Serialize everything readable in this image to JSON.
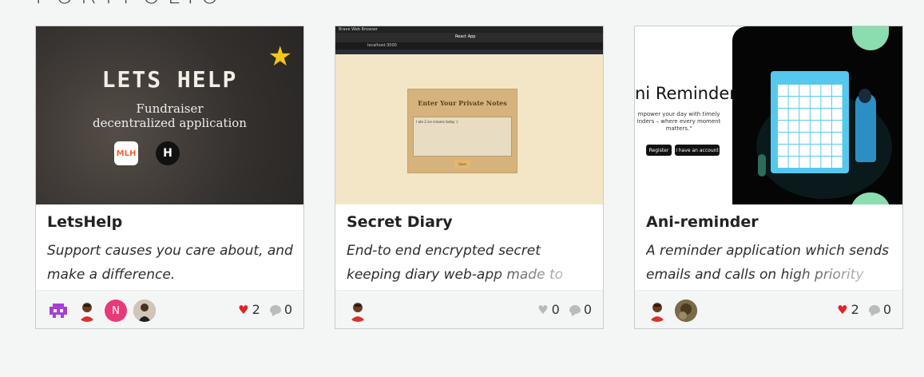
{
  "section": {
    "title": "PORTFOLIO"
  },
  "cards": [
    {
      "title": "LetsHelp",
      "description": "Support causes you care about, and make a difference.",
      "likes": "2",
      "comments": "0",
      "liked": true,
      "featured": true,
      "thumbnail": {
        "headline": "LETS HELP",
        "line1": "Fundraiser",
        "line2": "decentralized application",
        "badge1": "MLH",
        "badge2": "H"
      }
    },
    {
      "title": "Secret Diary",
      "description": "End-to end encrypted secret keeping diary web-app made to store and",
      "likes": "0",
      "comments": "0",
      "liked": false,
      "thumbnail": {
        "panel_title": "Enter Your Private Notes",
        "note_text": "I ate 2 ice creams today :)",
        "save_label": "Save",
        "browser_title": "Brave Web Browser",
        "tab_label": "React App",
        "url": "localhost:3000"
      }
    },
    {
      "title": "Ani-reminder",
      "description": "A reminder application which sends emails and calls on high priority",
      "likes": "2",
      "comments": "0",
      "liked": true,
      "thumbnail": {
        "heading": "ni Reminder",
        "tagline": "mpower your day with timely inders – where every moment matters.\"",
        "register_label": "Register",
        "account_label": "I have an account"
      }
    }
  ],
  "colors": {
    "heart_filled": "#e02424",
    "heart_empty": "#b9b9b9",
    "star": "#f5c518",
    "calendar": "#56c8ee",
    "mint": "#8bdcae"
  }
}
